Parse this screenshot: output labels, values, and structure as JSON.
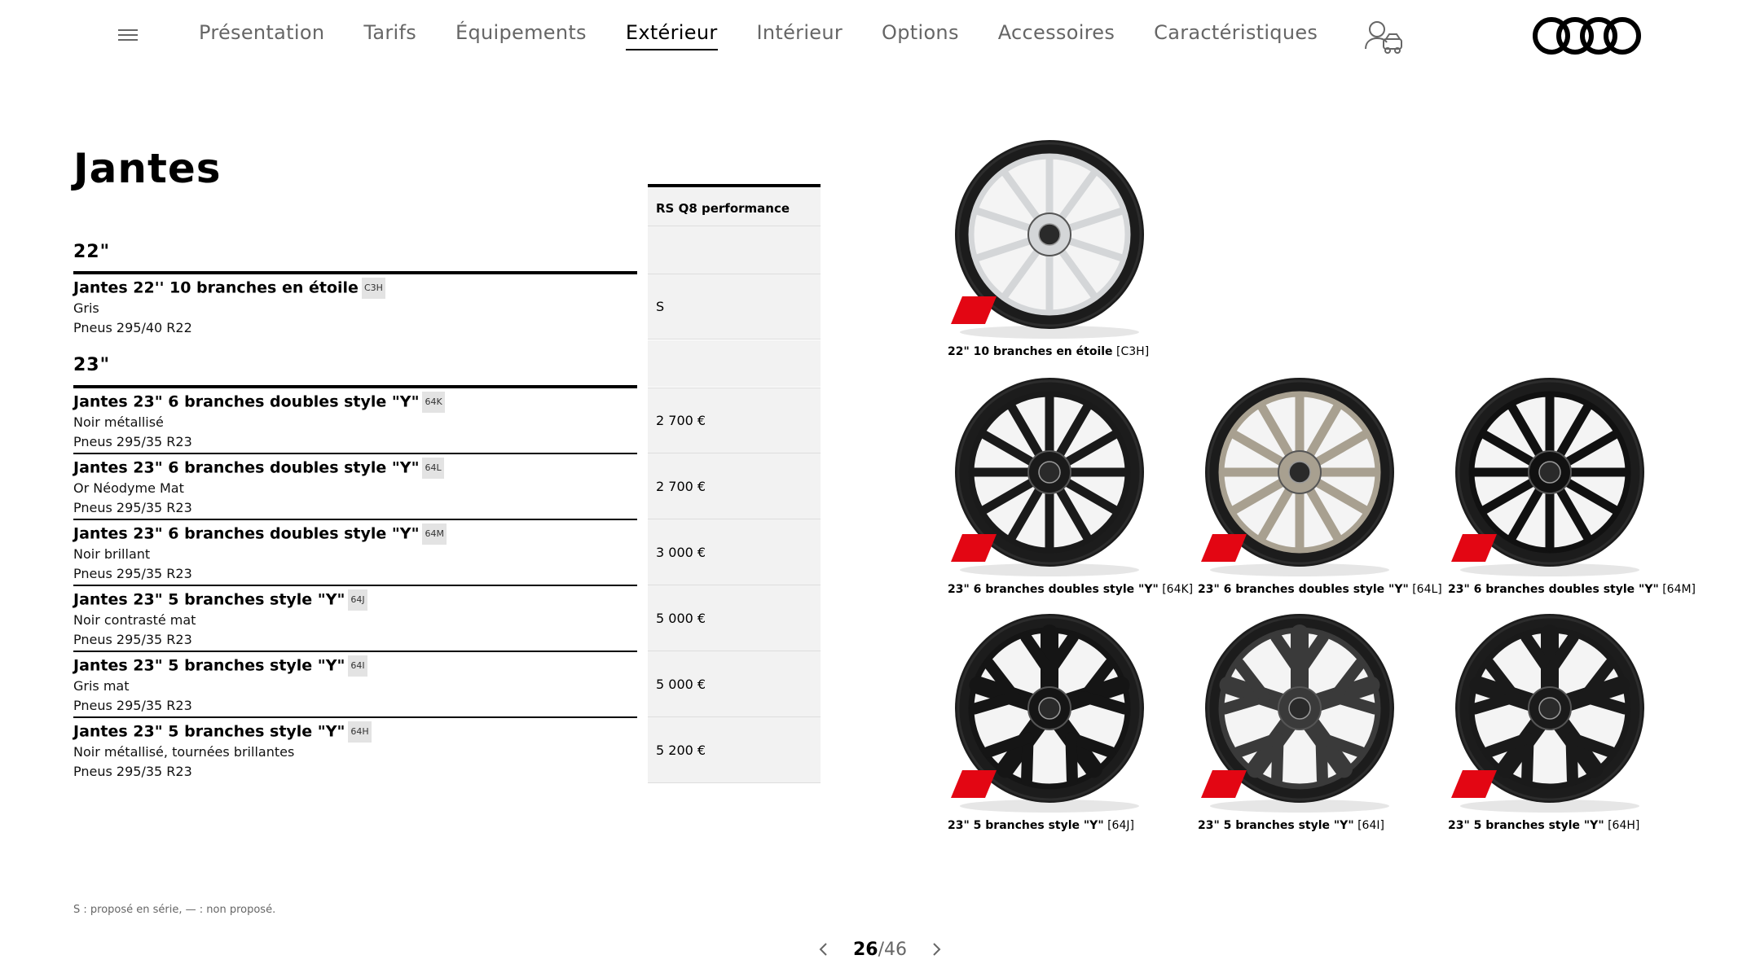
{
  "nav": {
    "menu_icon": "hamburger-icon",
    "items": [
      {
        "label": "Présentation",
        "active": false
      },
      {
        "label": "Tarifs",
        "active": false
      },
      {
        "label": "Équipements",
        "active": false
      },
      {
        "label": "Extérieur",
        "active": true
      },
      {
        "label": "Intérieur",
        "active": false
      },
      {
        "label": "Options",
        "active": false
      },
      {
        "label": "Accessoires",
        "active": false
      },
      {
        "label": "Caractéristiques",
        "active": false
      }
    ],
    "configurator_icon": "configurator-icon",
    "logo": "audi-rings-logo"
  },
  "title": "Jantes",
  "column_header": "RS Q8 performance",
  "sections": [
    {
      "label": "22\"",
      "rows": [
        {
          "title": "Jantes 22'' 10 branches en étoile",
          "code": "C3H",
          "color": "Gris",
          "tyres": "Pneus 295/40 R22",
          "price": "S"
        }
      ]
    },
    {
      "label": "23\"",
      "rows": [
        {
          "title": "Jantes 23\" 6 branches doubles style \"Y\"",
          "code": "64K",
          "color": "Noir métallisé",
          "tyres": "Pneus 295/35 R23",
          "price": "2 700 €"
        },
        {
          "title": "Jantes 23\" 6 branches doubles style \"Y\"",
          "code": "64L",
          "color": "Or Néodyme Mat",
          "tyres": "Pneus 295/35 R23",
          "price": "2 700 €"
        },
        {
          "title": "Jantes 23\" 6 branches doubles style \"Y\"",
          "code": "64M",
          "color": "Noir brillant",
          "tyres": "Pneus 295/35 R23",
          "price": "3 000 €"
        },
        {
          "title": "Jantes 23\" 5 branches style \"Y\"",
          "code": "64J",
          "color": "Noir contrasté mat",
          "tyres": "Pneus 295/35 R23",
          "price": "5 000 €"
        },
        {
          "title": "Jantes 23\" 5 branches style \"Y\"",
          "code": "64I",
          "color": "Gris mat",
          "tyres": "Pneus 295/35 R23",
          "price": "5 000 €"
        },
        {
          "title": "Jantes 23\" 5 branches style \"Y\"",
          "code": "64H",
          "color": "Noir métallisé, tournées brillantes",
          "tyres": "Pneus 295/35 R23",
          "price": "5 200 €"
        }
      ]
    }
  ],
  "footnote": "S : proposé en série, — : non proposé.",
  "wheels": [
    {
      "caption_bold": "22\" 10 branches en étoile",
      "caption_code": "[C3H]",
      "rim_color": "#d4d6d8",
      "spokes": 10
    },
    {
      "caption_bold": "23\" 6 branches doubles style \"Y\"",
      "caption_code": "[64K]",
      "rim_color": "#1a1a1a",
      "spokes": 12
    },
    {
      "caption_bold": "23\" 6 branches doubles style \"Y\"",
      "caption_code": "[64L]",
      "rim_color": "#a8a090",
      "spokes": 12
    },
    {
      "caption_bold": "23\" 6 branches doubles style \"Y\"",
      "caption_code": "[64M]",
      "rim_color": "#111111",
      "spokes": 12
    },
    {
      "caption_bold": "23\" 5 branches style \"Y\"",
      "caption_code": "[64J]",
      "rim_color": "#151515",
      "spokes": 5
    },
    {
      "caption_bold": "23\" 5 branches style \"Y\"",
      "caption_code": "[64I]",
      "rim_color": "#3a3a3a",
      "spokes": 5
    },
    {
      "caption_bold": "23\" 5 branches style \"Y\"",
      "caption_code": "[64H]",
      "rim_color": "#1a1a1a",
      "spokes": 5
    }
  ],
  "pager": {
    "current": "26",
    "total": "/46",
    "prev_icon": "chevron-left-icon",
    "next_icon": "chevron-right-icon"
  },
  "colors": {
    "accent_red": "#e30613",
    "cell_bg": "#f2f2f2",
    "nav_text": "#666666"
  }
}
